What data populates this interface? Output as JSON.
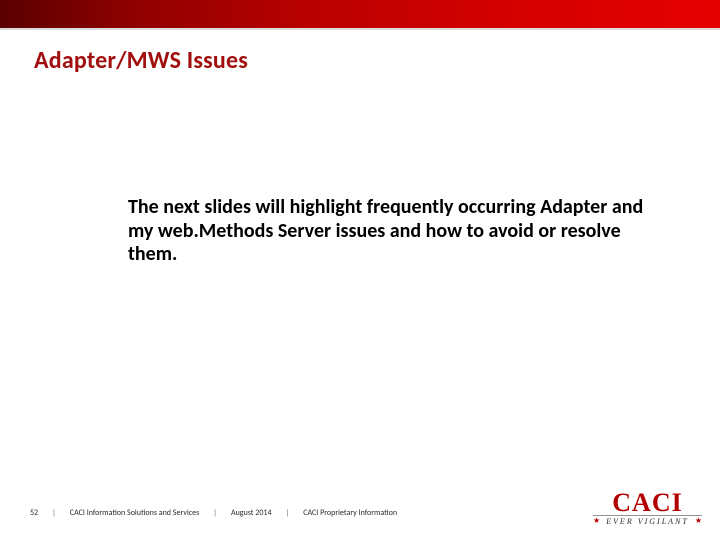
{
  "title": "Adapter/MWS Issues",
  "body": "The next slides will highlight frequently occurring Adapter and my web.Methods Server issues and how to avoid or resolve them.",
  "footer": {
    "page": "52",
    "org": "CACI Information Solutions and Services",
    "date": "August 2014",
    "classification": "CACI Proprietary Information",
    "separator": "|"
  },
  "logo": {
    "name": "CACI",
    "tagline": "EVER VIGILANT"
  }
}
